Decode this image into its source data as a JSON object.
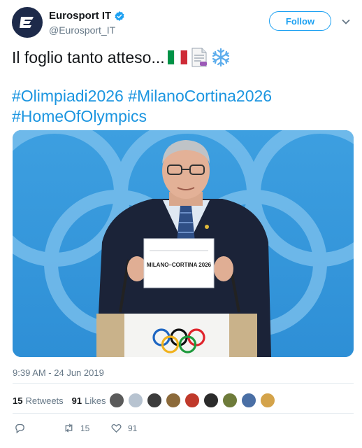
{
  "header": {
    "display_name": "Eurosport IT",
    "handle": "@Eurosport_IT",
    "follow_label": "Follow"
  },
  "tweet": {
    "text": "Il foglio tanto atteso...",
    "emojis": [
      "italy-flag-icon",
      "page-facing-up-icon",
      "snowflake-icon"
    ],
    "hashtags": [
      "#Olimpiadi2026 #MilanoCortina2026",
      "#HomeOfOlympics"
    ]
  },
  "media": {
    "card_text": "MILANO–CORTINA 2026"
  },
  "meta": {
    "timestamp": "9:39 AM - 24 Jun 2019"
  },
  "stats": {
    "retweets_count": "15",
    "retweets_label": "Retweets",
    "likes_count": "91",
    "likes_label": "Likes",
    "liker_colors": [
      "#5a5a5a",
      "#b7c3d0",
      "#3b3b3b",
      "#8c6a3a",
      "#c0392b",
      "#2b2b2b",
      "#6e7b3a",
      "#4a6fa5",
      "#d4a34a"
    ]
  },
  "actions": {
    "reply_count": "",
    "retweet_count": "15",
    "like_count": "91"
  },
  "colors": {
    "accent": "#1da1f2",
    "hashtag": "#1b95e0",
    "muted": "#657786"
  }
}
